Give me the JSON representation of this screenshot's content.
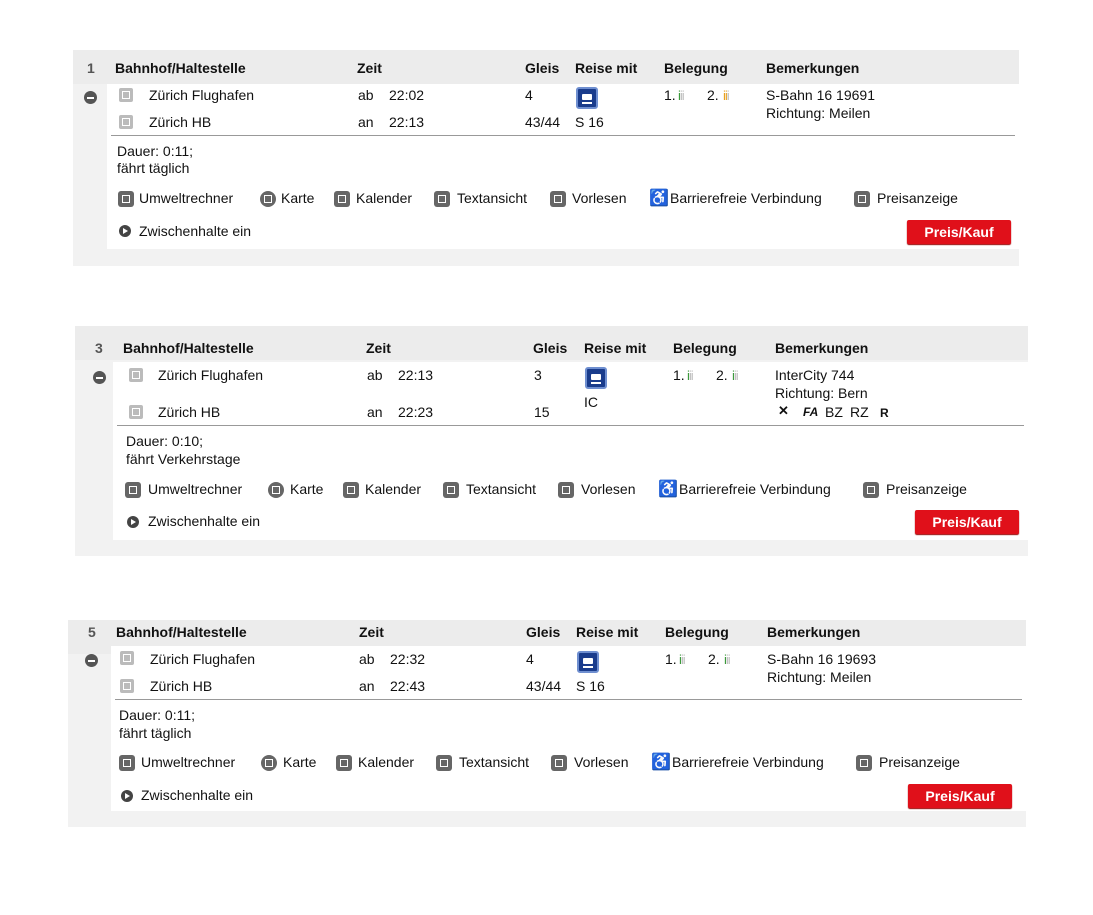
{
  "columns": {
    "station": "Bahnhof/Haltestelle",
    "time": "Zeit",
    "platform": "Gleis",
    "travel_with": "Reise mit",
    "occupancy": "Belegung",
    "remarks": "Bemerkungen"
  },
  "occupancy_labels": {
    "first": "1.",
    "second": "2."
  },
  "footer_links": {
    "umwelt": "Umweltrechner",
    "karte": "Karte",
    "kalender": "Kalender",
    "textansicht": "Textansicht",
    "vorlesen": "Vorlesen",
    "barrierefrei": "Barrierefreie Verbindung",
    "preisanzeige": "Preisanzeige",
    "zwischenhalte": "Zwischenhalte ein",
    "buy": "Preis/Kauf"
  },
  "colors": {
    "buy_button": "#e0101a",
    "occupancy_low": "#3a9a3a",
    "occupancy_medium": "#e8a020",
    "train_icon": "#1a3c8c"
  },
  "connections": [
    {
      "index": "1",
      "from": {
        "station": "Zürich Flughafen",
        "type": "ab",
        "time": "22:02",
        "platform": "4"
      },
      "to": {
        "station": "Zürich HB",
        "type": "an",
        "time": "22:13",
        "platform": "43/44"
      },
      "product": "S 16",
      "occupancy_first": "low",
      "occupancy_second": "medium",
      "remark_1": "S-Bahn 16 19691",
      "remark_2": "Richtung: Meilen",
      "duration": "Dauer: 0:11;",
      "schedule": "fährt täglich"
    },
    {
      "index": "3",
      "from": {
        "station": "Zürich Flughafen",
        "type": "ab",
        "time": "22:13",
        "platform": "3"
      },
      "to": {
        "station": "Zürich HB",
        "type": "an",
        "time": "22:23",
        "platform": "15"
      },
      "product": "IC",
      "occupancy_first": "low",
      "occupancy_second": "low",
      "remark_1": "InterCity 744",
      "remark_2": "Richtung: Bern",
      "remark_codes": [
        "FA",
        "BZ",
        "RZ",
        "R"
      ],
      "duration": "Dauer: 0:10;",
      "schedule": "fährt Verkehrstage"
    },
    {
      "index": "5",
      "from": {
        "station": "Zürich Flughafen",
        "type": "ab",
        "time": "22:32",
        "platform": "4"
      },
      "to": {
        "station": "Zürich HB",
        "type": "an",
        "time": "22:43",
        "platform": "43/44"
      },
      "product": "S 16",
      "occupancy_first": "low",
      "occupancy_second": "low",
      "remark_1": "S-Bahn 16 19693",
      "remark_2": "Richtung: Meilen",
      "duration": "Dauer: 0:11;",
      "schedule": "fährt täglich"
    }
  ]
}
